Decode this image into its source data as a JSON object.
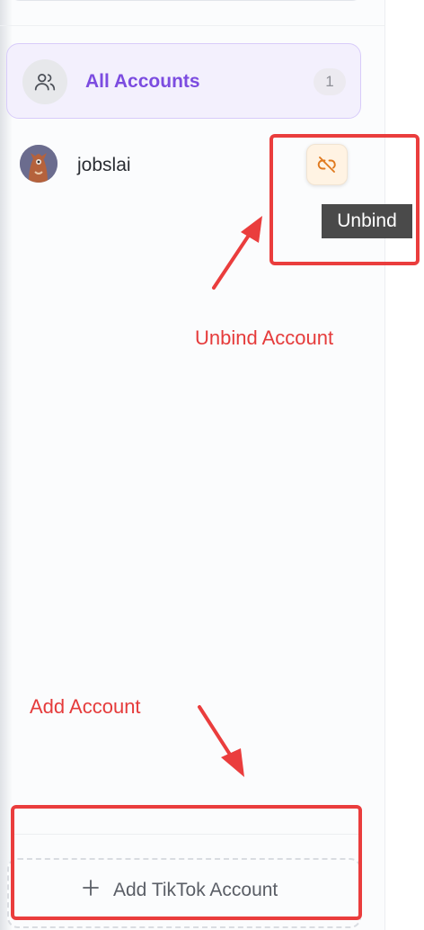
{
  "sidebar": {
    "all_accounts": {
      "label": "All Accounts",
      "count": "1",
      "icon": "users-icon"
    },
    "accounts": [
      {
        "name": "jobslai",
        "action_icon": "unlink-icon",
        "action_tooltip": "Unbind"
      }
    ],
    "add_button": {
      "label": "Add TikTok Account",
      "icon": "plus-icon"
    }
  },
  "annotations": {
    "unbind": "Unbind Account",
    "add": "Add Account",
    "color": "#ea3d3d"
  },
  "colors": {
    "accent": "#7c4ce0",
    "unbind_icon": "#e07a1f"
  }
}
